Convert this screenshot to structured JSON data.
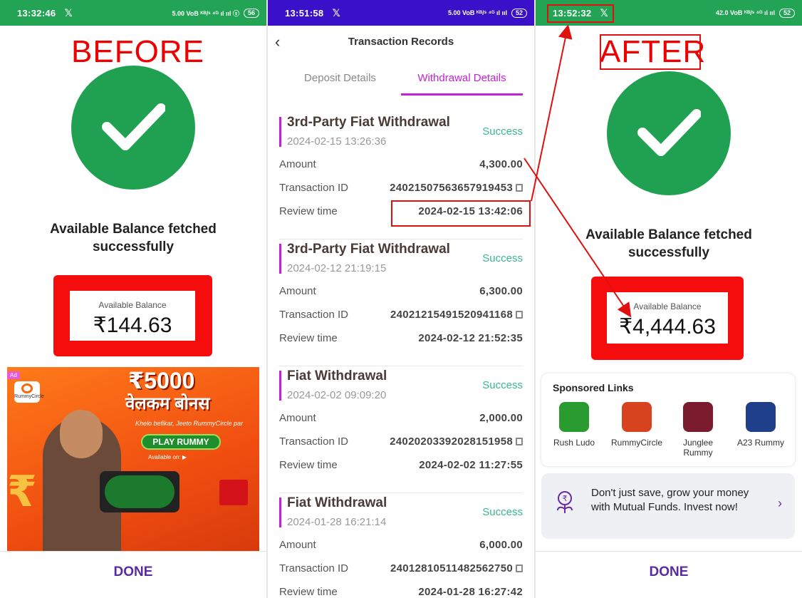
{
  "before": {
    "status_time": "13:32:46",
    "status_icons": "5.00 VoB ᴷᴮ/ˢ ⁴ᴳ ıl ııl ⓢ",
    "battery": "56",
    "label": "BEFORE",
    "caption": "Available Balance fetched successfully",
    "balance_label": "Available Balance",
    "balance_value": "₹144.63",
    "ad": {
      "tag": "Ad",
      "brand": "RummyCircle",
      "bonus": "₹5000",
      "bonus_hindi": "वेलकम बोनस",
      "tagline": "Khelo befikar, Jeeto RummyCircle par",
      "cta": "PLAY RUMMY",
      "available": "Available on:"
    },
    "done": "DONE"
  },
  "transactions": {
    "status_time": "13:51:58",
    "status_icons": "5.00 VoB ᴷᴮ/ˢ ⁴ᴳ ıl ııl",
    "battery": "52",
    "title": "Transaction Records",
    "tabs": [
      {
        "label": "Deposit Details"
      },
      {
        "label": "Withdrawal Details"
      }
    ],
    "labels": {
      "amount": "Amount",
      "txid": "Transaction ID",
      "review": "Review time"
    },
    "records": [
      {
        "type": "3rd-Party Fiat Withdrawal",
        "date": "2024-02-15 13:26:36",
        "status": "Success",
        "amount": "4,300.00",
        "txid": "24021507563657919453",
        "review": "2024-02-15 13:42:06"
      },
      {
        "type": "3rd-Party Fiat Withdrawal",
        "date": "2024-02-12 21:19:15",
        "status": "Success",
        "amount": "6,300.00",
        "txid": "24021215491520941168",
        "review": "2024-02-12 21:52:35"
      },
      {
        "type": "Fiat Withdrawal",
        "date": "2024-02-02 09:09:20",
        "status": "Success",
        "amount": "2,000.00",
        "txid": "24020203392028151958",
        "review": "2024-02-02 11:27:55"
      },
      {
        "type": "Fiat Withdrawal",
        "date": "2024-01-28 16:21:14",
        "status": "Success",
        "amount": "6,000.00",
        "txid": "24012810511482562750",
        "review": "2024-01-28 16:27:42"
      }
    ]
  },
  "after": {
    "status_time": "13:52:32",
    "status_icons": "42.0 VoB ᴷᴮ/ˢ ⁴ᴳ ıl ııl",
    "battery": "52",
    "label": "AFTER",
    "caption": "Available Balance fetched successfully",
    "balance_label": "Available Balance",
    "balance_value": "₹4,444.63",
    "sponsored_title": "Sponsored Links",
    "apps": [
      {
        "name": "Rush Ludo",
        "color": "#2a9b2f"
      },
      {
        "name": "RummyCircle",
        "color": "#d8431f"
      },
      {
        "name": "Junglee Rummy",
        "color": "#7a1c2e"
      },
      {
        "name": "A23 Rummy",
        "color": "#1f3f8a"
      }
    ],
    "mf_text": "Don't just save, grow your money with Mutual Funds. Invest now!",
    "done": "DONE"
  },
  "colors": {
    "success_green": "#20a152",
    "highlight_red": "#f50d0d",
    "accent_purple": "#c222d6"
  }
}
